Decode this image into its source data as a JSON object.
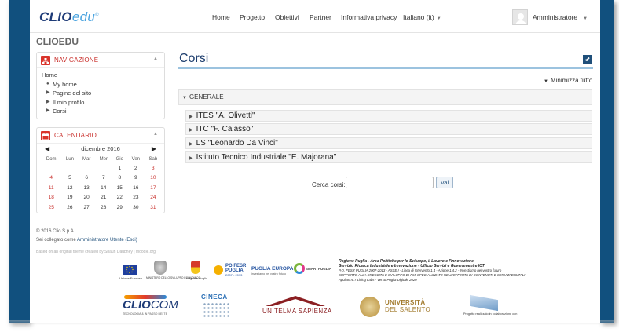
{
  "navbar": {
    "brand_clio": "CLIO",
    "brand_edu": "EDU",
    "brand_reg": "®",
    "links": [
      "Home",
      "Progetto",
      "Obiettivi",
      "Partner",
      "Informativa privacy"
    ],
    "language": "Italiano (it)",
    "user": "Amministratore"
  },
  "site_title": "CLIOEDU",
  "navigation_block": {
    "title": "NAVIGAZIONE",
    "home": "Home",
    "items": [
      {
        "marker": "bullet",
        "label": "My home"
      },
      {
        "marker": "arrow",
        "label": "Pagine del sito"
      },
      {
        "marker": "arrow",
        "label": "Il mio profilo"
      },
      {
        "marker": "arrow",
        "label": "Corsi"
      }
    ]
  },
  "calendar_block": {
    "title": "CALENDARIO",
    "month": "dicembre 2016",
    "weekdays": [
      "Dom",
      "Lun",
      "Mar",
      "Mer",
      "Gio",
      "Ven",
      "Sab"
    ],
    "weeks": [
      [
        "",
        "",
        "",
        "",
        "1",
        "2",
        "3"
      ],
      [
        "4",
        "5",
        "6",
        "7",
        "8",
        "9",
        "10"
      ],
      [
        "11",
        "12",
        "13",
        "14",
        "15",
        "16",
        "17"
      ],
      [
        "18",
        "19",
        "20",
        "21",
        "22",
        "23",
        "24"
      ],
      [
        "25",
        "26",
        "27",
        "28",
        "29",
        "30",
        "31"
      ]
    ]
  },
  "main": {
    "title": "Corsi",
    "collapse_all": "Minimizza tutto",
    "category": "GENERALE",
    "courses": [
      "ITES \"A. Olivetti\"",
      "ITC \"F. Calasso\"",
      "LS \"Leonardo Da Vinci\"",
      "Istituto Tecnico Industriale \"E. Majorana\""
    ],
    "search_label": "Cerca corsi:",
    "search_value": "",
    "search_button": "Vai"
  },
  "footer": {
    "copyright": "© 2016 Clio S.p.A.",
    "logged_prefix": "Sei collegato come",
    "logged_user": "Amministratore Utente",
    "logout": "(Esci)",
    "theme_note": "Based on an original theme created by Shaun Daubney | moodle.org"
  },
  "logos": {
    "eu_caption": "Unione Europea",
    "ministry_caption": "MINISTERO DELLO SVILUPPO ECONOMICO",
    "regione_caption": "Regione Puglia",
    "pofesr_line1": "PO FESR",
    "pofesr_line2": "PUGLIA",
    "pofesr_line3": "2007 - 2013",
    "puglia_europa": "PUGLIA EUROPA",
    "puglia_europa_sub": "investiamo nel vostro futuro",
    "smart": "SMARTPUGLIA",
    "legal_line1": "Regione Puglia - Area Politiche per lo Sviluppo, il Lavoro e l'Innovazione",
    "legal_line2": "Servizio Ricerca Industriale e Innovazione - Ufficio Servizi e Government e ICT",
    "legal_line3": "P.O. FESR PUGLIA 2007-2013 - ASSE I - Linea di Intervento 1.4 - Azione 1.4.2 - Investiamo nel vostro futuro",
    "legal_line4": "SUPPORTO ALLA CRESCITA E SVILUPPO DI PMI SPECIALIZZATE NELL'OFFERTA DI CONTENUTI E SERVIZI DIGITALI",
    "legal_line5": "Apulian ICT Living Labs - Verso Puglia Digitale 2020",
    "cliocom": "CLIO",
    "cliocom_suffix": "COM",
    "cliocom_tag": "TECNOLOGIA & IN PASSO DEI TE",
    "cineca": "CINECA",
    "sapienza": "UNITELMA SAPIENZA",
    "salento_line1": "UNIVERSITÀ",
    "salento_line2": "DEL SALENTO",
    "last_caption": "Progetto realizzato in collaborazione con"
  },
  "colors": {
    "frame": "#11507e",
    "accent_red": "#c9302c",
    "title_blue": "#1e3e6e"
  }
}
